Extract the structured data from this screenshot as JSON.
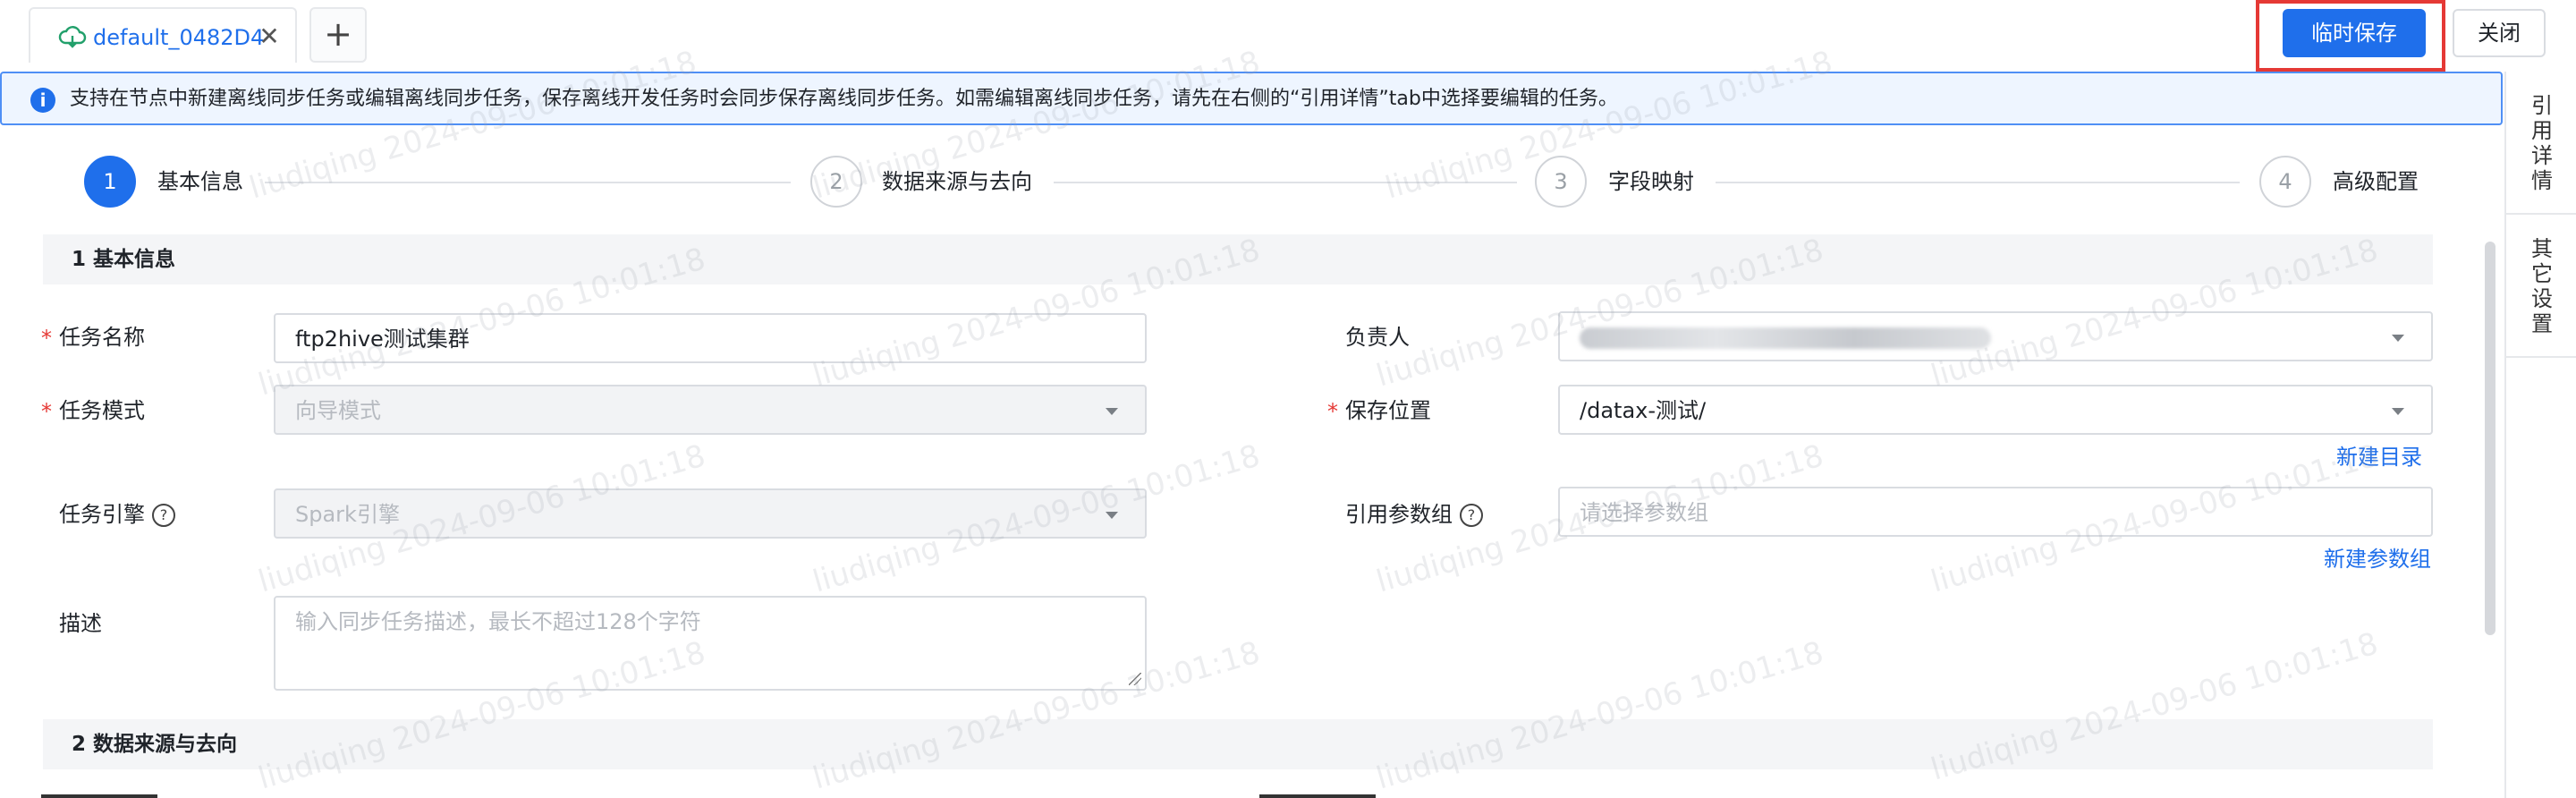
{
  "tab": {
    "title": "default_0482D4",
    "icon": "cloud-sync-icon",
    "close_glyph": "✕"
  },
  "add_tab_glyph": "+",
  "actions": {
    "temp_save": "临时保存",
    "close": "关闭"
  },
  "banner": {
    "icon": "info-icon",
    "icon_glyph": "i",
    "text": "支持在节点中新建离线同步任务或编辑离线同步任务，保存离线开发任务时会同步保存离线同步任务。如需编辑离线同步任务，请先在右侧的“引用详情”tab中选择要编辑的任务。"
  },
  "side_tabs": [
    "引用详情",
    "其它设置"
  ],
  "steps": [
    {
      "num": "1",
      "label": "基本信息",
      "active": true
    },
    {
      "num": "2",
      "label": "数据来源与去向",
      "active": false
    },
    {
      "num": "3",
      "label": "字段映射",
      "active": false
    },
    {
      "num": "4",
      "label": "高级配置",
      "active": false
    }
  ],
  "sections": {
    "basic": "1 基本信息",
    "source": "2 数据来源与去向"
  },
  "form": {
    "task_name": {
      "label": "任务名称",
      "value": "ftp2hive测试集群",
      "required": true
    },
    "task_mode": {
      "label": "任务模式",
      "value": "向导模式",
      "required": true,
      "disabled": true
    },
    "task_engine": {
      "label": "任务引擎",
      "value": "Spark引擎",
      "disabled": true,
      "help": "?"
    },
    "description": {
      "label": "描述",
      "placeholder": "输入同步任务描述，最长不超过128个字符"
    },
    "owner": {
      "label": "负责人",
      "value": ""
    },
    "save_location": {
      "label": "保存位置",
      "value": "/datax-测试/",
      "required": true
    },
    "param_group": {
      "label": "引用参数组",
      "placeholder": "请选择参数组",
      "help": "?"
    },
    "new_dir_link": "新建目录",
    "new_param_group_link": "新建参数组"
  },
  "watermark": "liudiqing 2024-09-06 10:01:18",
  "colors": {
    "primary": "#1f6feb",
    "danger": "#e53935",
    "banner_bg": "#eef5ff"
  }
}
